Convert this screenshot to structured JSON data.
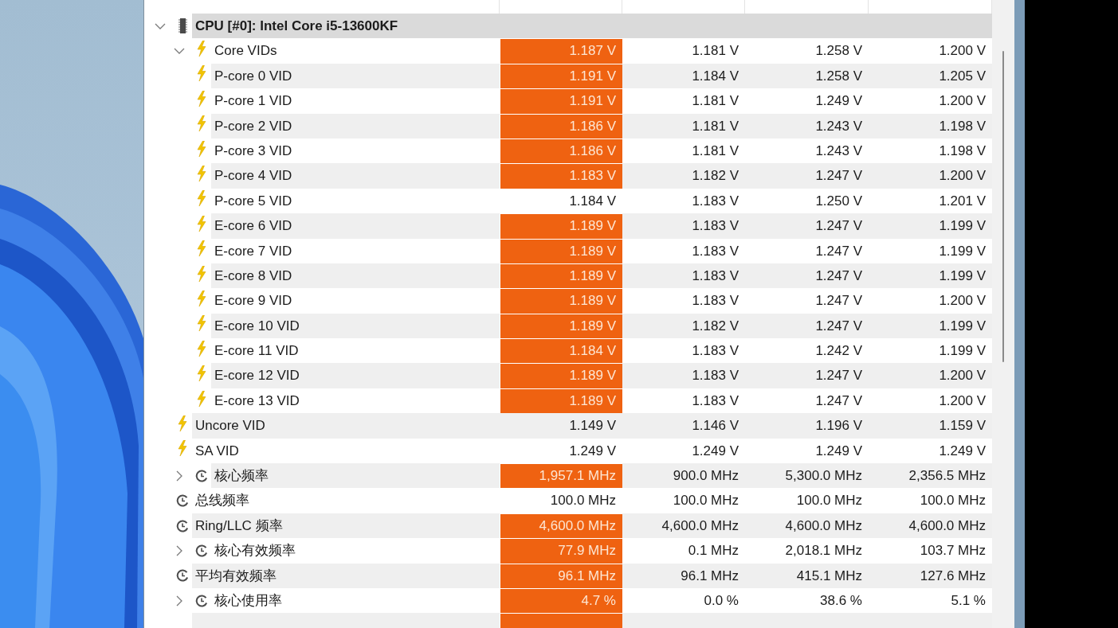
{
  "sensor_tree": [
    {
      "kind": "device",
      "label": "CPU [#0]: Intel Core i5-13600KF",
      "expanded": true,
      "children": [
        {
          "kind": "voltage",
          "label": "Core VIDs",
          "expanded": true,
          "highlighted": true,
          "values": [
            "1.187 V",
            "1.181 V",
            "1.258 V",
            "1.200 V"
          ],
          "children": [
            {
              "kind": "voltage",
              "label": "P-core 0 VID",
              "highlighted": true,
              "values": [
                "1.191 V",
                "1.184 V",
                "1.258 V",
                "1.205 V"
              ]
            },
            {
              "kind": "voltage",
              "label": "P-core 1 VID",
              "highlighted": true,
              "values": [
                "1.191 V",
                "1.181 V",
                "1.249 V",
                "1.200 V"
              ]
            },
            {
              "kind": "voltage",
              "label": "P-core 2 VID",
              "highlighted": true,
              "values": [
                "1.186 V",
                "1.181 V",
                "1.243 V",
                "1.198 V"
              ]
            },
            {
              "kind": "voltage",
              "label": "P-core 3 VID",
              "highlighted": true,
              "values": [
                "1.186 V",
                "1.181 V",
                "1.243 V",
                "1.198 V"
              ]
            },
            {
              "kind": "voltage",
              "label": "P-core 4 VID",
              "highlighted": true,
              "values": [
                "1.183 V",
                "1.182 V",
                "1.247 V",
                "1.200 V"
              ]
            },
            {
              "kind": "voltage",
              "label": "P-core 5 VID",
              "highlighted": false,
              "values": [
                "1.184 V",
                "1.183 V",
                "1.250 V",
                "1.201 V"
              ]
            },
            {
              "kind": "voltage",
              "label": "E-core 6 VID",
              "highlighted": true,
              "values": [
                "1.189 V",
                "1.183 V",
                "1.247 V",
                "1.199 V"
              ]
            },
            {
              "kind": "voltage",
              "label": "E-core 7 VID",
              "highlighted": true,
              "values": [
                "1.189 V",
                "1.183 V",
                "1.247 V",
                "1.199 V"
              ]
            },
            {
              "kind": "voltage",
              "label": "E-core 8 VID",
              "highlighted": true,
              "values": [
                "1.189 V",
                "1.183 V",
                "1.247 V",
                "1.199 V"
              ]
            },
            {
              "kind": "voltage",
              "label": "E-core 9 VID",
              "highlighted": true,
              "values": [
                "1.189 V",
                "1.183 V",
                "1.247 V",
                "1.200 V"
              ]
            },
            {
              "kind": "voltage",
              "label": "E-core 10 VID",
              "highlighted": true,
              "values": [
                "1.189 V",
                "1.182 V",
                "1.247 V",
                "1.199 V"
              ]
            },
            {
              "kind": "voltage",
              "label": "E-core 11 VID",
              "highlighted": true,
              "values": [
                "1.184 V",
                "1.183 V",
                "1.242 V",
                "1.199 V"
              ]
            },
            {
              "kind": "voltage",
              "label": "E-core 12 VID",
              "highlighted": true,
              "values": [
                "1.189 V",
                "1.183 V",
                "1.247 V",
                "1.200 V"
              ]
            },
            {
              "kind": "voltage",
              "label": "E-core 13 VID",
              "highlighted": true,
              "values": [
                "1.189 V",
                "1.183 V",
                "1.247 V",
                "1.200 V"
              ]
            }
          ]
        },
        {
          "kind": "voltage",
          "label": "Uncore VID",
          "highlighted": false,
          "values": [
            "1.149 V",
            "1.146 V",
            "1.196 V",
            "1.159 V"
          ]
        },
        {
          "kind": "voltage",
          "label": "SA VID",
          "highlighted": false,
          "values": [
            "1.249 V",
            "1.249 V",
            "1.249 V",
            "1.249 V"
          ]
        },
        {
          "kind": "clock",
          "label": "核心频率",
          "expanded": false,
          "highlighted": true,
          "values": [
            "1,957.1 MHz",
            "900.0 MHz",
            "5,300.0 MHz",
            "2,356.5 MHz"
          ]
        },
        {
          "kind": "clock",
          "label": "总线频率",
          "highlighted": false,
          "values": [
            "100.0 MHz",
            "100.0 MHz",
            "100.0 MHz",
            "100.0 MHz"
          ]
        },
        {
          "kind": "clock",
          "label": "Ring/LLC 频率",
          "highlighted": true,
          "values": [
            "4,600.0 MHz",
            "4,600.0 MHz",
            "4,600.0 MHz",
            "4,600.0 MHz"
          ]
        },
        {
          "kind": "clock",
          "label": "核心有效频率",
          "expanded": false,
          "highlighted": true,
          "values": [
            "77.9 MHz",
            "0.1 MHz",
            "2,018.1 MHz",
            "103.7 MHz"
          ]
        },
        {
          "kind": "clock",
          "label": "平均有效频率",
          "highlighted": true,
          "values": [
            "96.1 MHz",
            "96.1 MHz",
            "415.1 MHz",
            "127.6 MHz"
          ]
        },
        {
          "kind": "clock",
          "label": "核心使用率",
          "expanded": false,
          "highlighted": true,
          "values": [
            "4.7 %",
            "0.0 %",
            "38.6 %",
            "5.1 %"
          ]
        }
      ]
    }
  ],
  "cut_off_row": {
    "highlighted": true
  }
}
